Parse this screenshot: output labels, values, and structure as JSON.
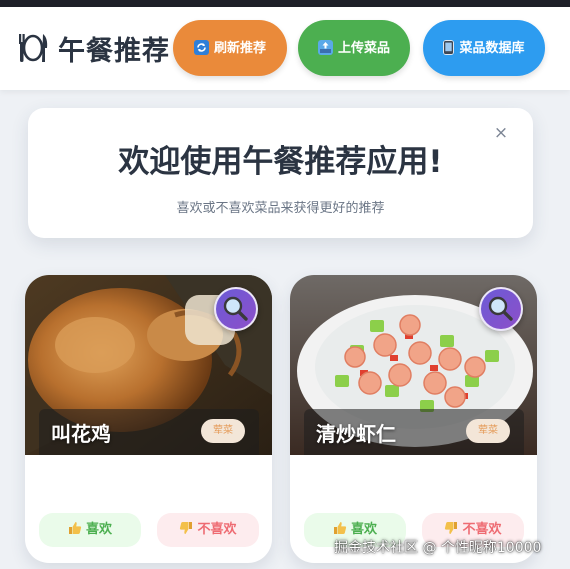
{
  "header": {
    "title": "午餐推荐",
    "buttons": {
      "refresh": "刷新推荐",
      "upload": "上传菜品",
      "database": "菜品数据库"
    }
  },
  "welcome": {
    "title": "欢迎使用午餐推荐应用!",
    "subtitle": "喜欢或不喜欢菜品来获得更好的推荐",
    "close": "×"
  },
  "dishes": [
    {
      "name": "叫花鸡",
      "tag": "荤菜",
      "like": "喜欢",
      "dislike": "不喜欢"
    },
    {
      "name": "清炒虾仁",
      "tag": "荤菜",
      "like": "喜欢",
      "dislike": "不喜欢"
    }
  ],
  "watermark": "掘金技术社区 @ 个性昵称10000",
  "colors": {
    "refresh": "#ea8a3a",
    "upload": "#4caf50",
    "database": "#2d9cf0",
    "like": "#4caf50",
    "dislike": "#ee6b72"
  }
}
